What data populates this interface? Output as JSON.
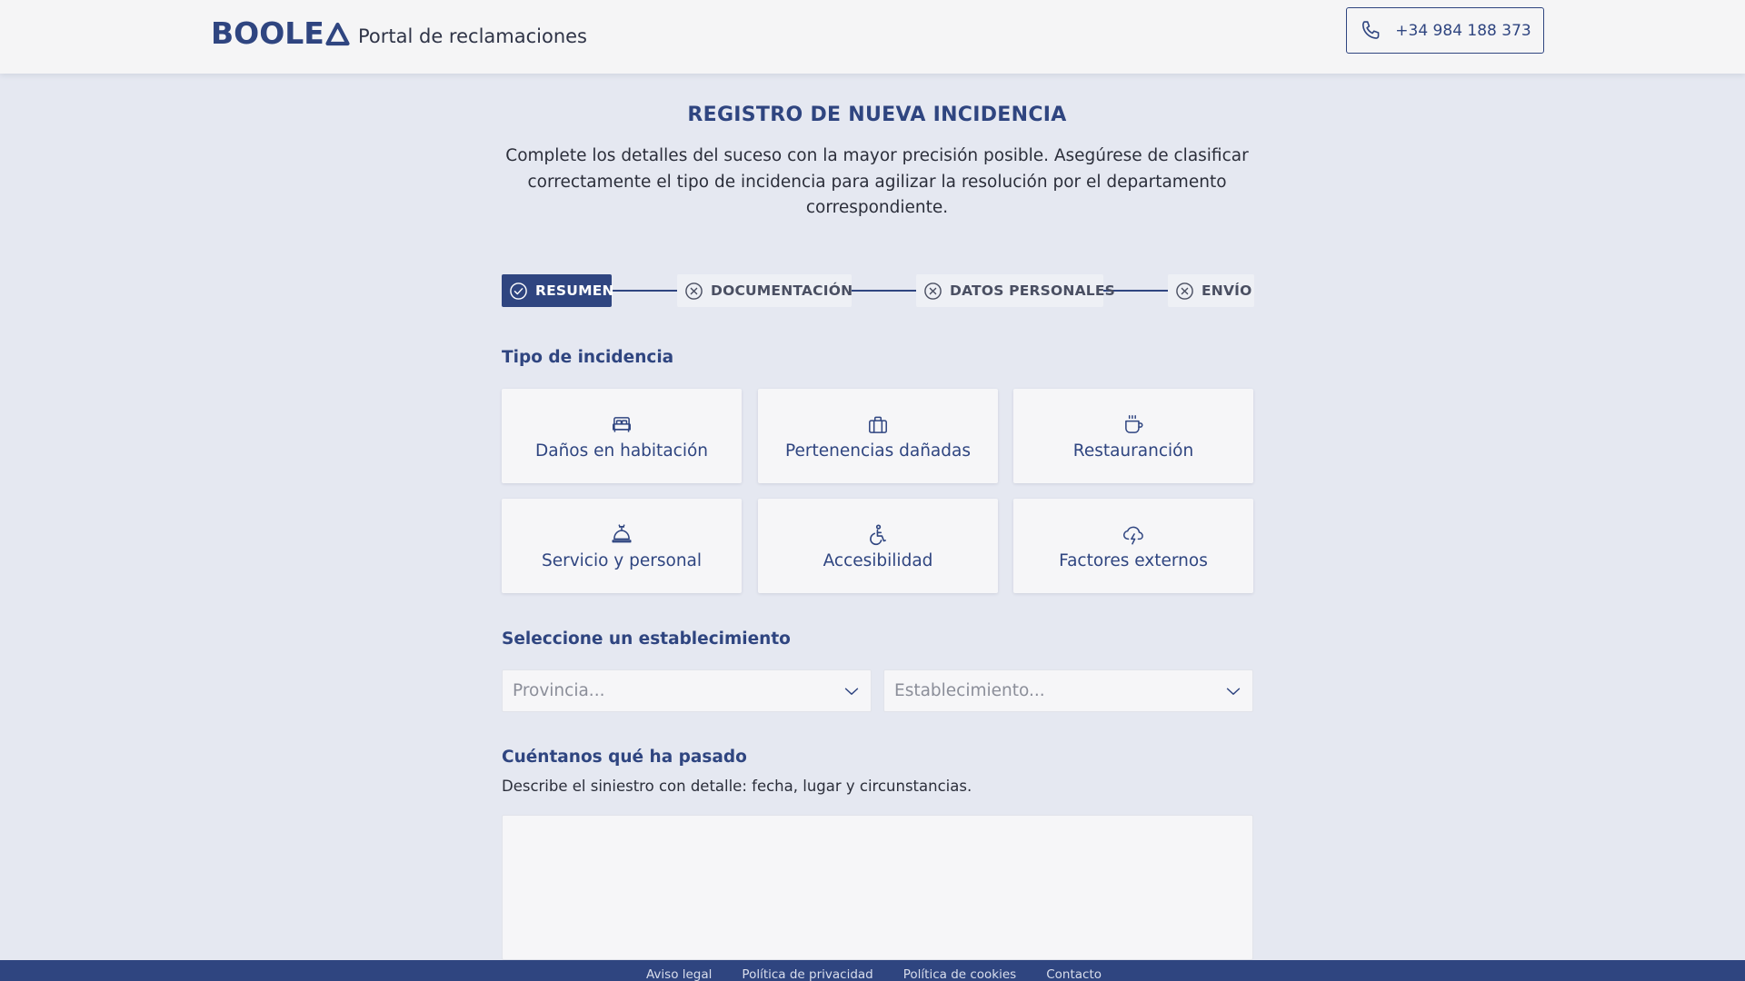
{
  "header": {
    "logo_text": "BOOLE",
    "portal_title": "Portal de reclamaciones",
    "phone": "+34 984 188 373"
  },
  "main": {
    "title": "REGISTRO DE NUEVA INCIDENCIA",
    "intro": "Complete los detalles del suceso con la mayor precisión posible. Asegúrese de clasificar correctamente el tipo de incidencia para agilizar la resolución por el departamento correspondiente."
  },
  "stepper": {
    "steps": [
      {
        "label": "RESUMEN",
        "state": "active",
        "icon": "check-circle-icon"
      },
      {
        "label": "DOCUMENTACIÓN",
        "state": "pending",
        "icon": "x-circle-icon"
      },
      {
        "label": "DATOS PERSONALES",
        "state": "pending",
        "icon": "x-circle-icon"
      },
      {
        "label": "ENVÍO",
        "state": "pending",
        "icon": "x-circle-icon"
      }
    ]
  },
  "incident": {
    "title": "Tipo de incidencia",
    "options": [
      {
        "label": "Daños en habitación",
        "icon": "bed-icon"
      },
      {
        "label": "Pertenencias dañadas",
        "icon": "suitcase-icon"
      },
      {
        "label": "Restauranción",
        "icon": "coffee-cup-icon"
      },
      {
        "label": "Servicio y personal",
        "icon": "service-bell-icon"
      },
      {
        "label": "Accesibilidad",
        "icon": "wheelchair-icon"
      },
      {
        "label": "Factores externos",
        "icon": "storm-cloud-icon"
      }
    ]
  },
  "establishment": {
    "title": "Seleccione un establecimiento",
    "province_placeholder": "Provincia...",
    "establishment_placeholder": "Establecimiento..."
  },
  "description": {
    "title": "Cuéntanos qué ha pasado",
    "subtext": "Describe el siniestro con detalle: fecha, lugar y circunstancias.",
    "value": ""
  },
  "footer": {
    "links": [
      "Aviso legal",
      "Política de privacidad",
      "Política de cookies",
      "Contacto"
    ]
  },
  "colors": {
    "primary": "#2f4580",
    "background": "#e5e8f1",
    "header_bg": "#f5f5f6",
    "card_bg": "#f6f6f8"
  }
}
